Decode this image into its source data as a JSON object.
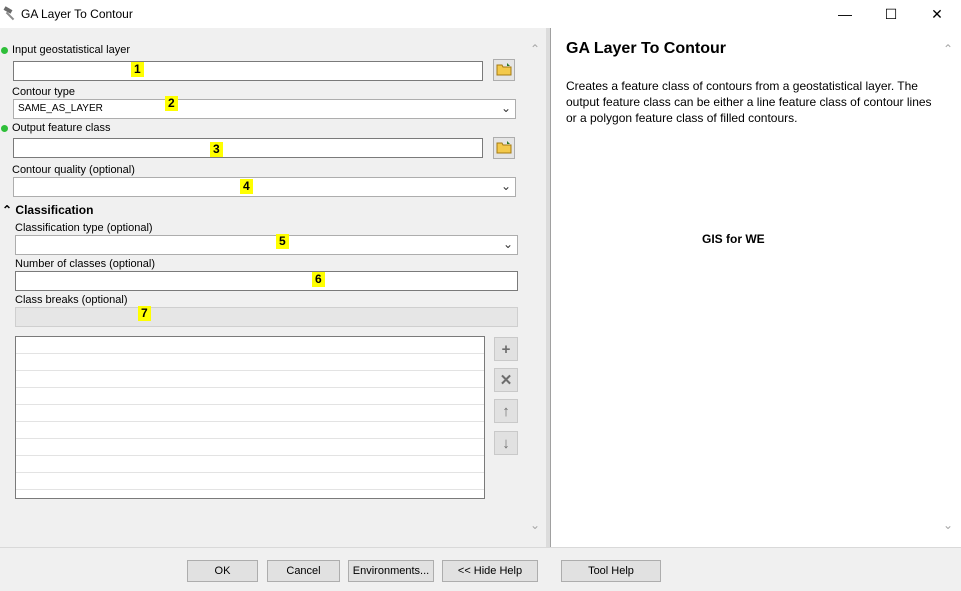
{
  "window": {
    "title": "GA Layer To Contour",
    "minimize": "—",
    "maximize": "☐",
    "close": "✕"
  },
  "form": {
    "input_layer_label": "Input geostatistical layer",
    "contour_type_label": "Contour type",
    "contour_type_value": "SAME_AS_LAYER",
    "output_class_label": "Output feature class",
    "contour_quality_label": "Contour quality (optional)",
    "classification_header": "Classification",
    "classification_type_label": "Classification type (optional)",
    "num_classes_label": "Number of classes (optional)",
    "class_breaks_label": "Class breaks (optional)"
  },
  "annotations": [
    "1",
    "2",
    "3",
    "4",
    "5",
    "6",
    "7"
  ],
  "help": {
    "title": "GA Layer To Contour",
    "description": "Creates a feature class of contours from a geostatistical layer. The output feature class can be either a line feature class of contour lines or a polygon feature class of filled contours.",
    "watermark": "GIS for WE"
  },
  "buttons": {
    "ok": "OK",
    "cancel": "Cancel",
    "environments": "Environments...",
    "hide_help": "<< Hide Help",
    "tool_help": "Tool Help"
  },
  "colors": {
    "required_dot": "#2fbf3a",
    "annotation_highlight": "#ffff00",
    "panel_bg": "#f0f0f0"
  }
}
